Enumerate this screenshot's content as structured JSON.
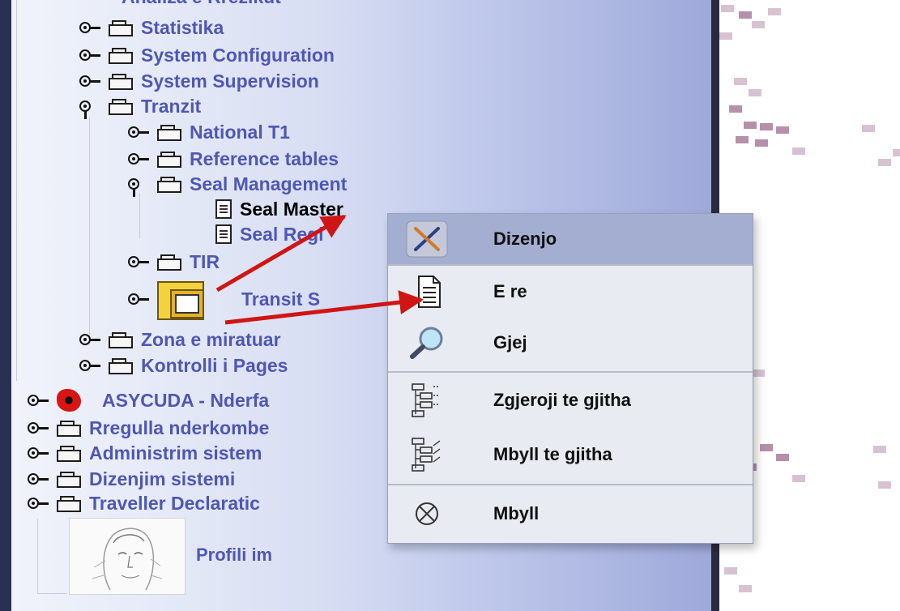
{
  "tree": {
    "top_partial": "Analiza e Rrezikut",
    "items": [
      {
        "label": "Statistika"
      },
      {
        "label": "System Configuration"
      },
      {
        "label": "System Supervision"
      },
      {
        "label": "Tranzit"
      },
      {
        "label": "National T1"
      },
      {
        "label": "Reference tables"
      },
      {
        "label": "Seal Management"
      },
      {
        "label": "Seal Master"
      },
      {
        "label": "Seal Regi"
      },
      {
        "label": "TIR"
      },
      {
        "label": "Transit S"
      },
      {
        "label": "Zona e miratuar"
      },
      {
        "label": "Kontrolli i Pages"
      },
      {
        "label": "ASYCUDA - Nderfa"
      },
      {
        "label": "Rregulla nderkombe"
      },
      {
        "label": "Administrim sistem"
      },
      {
        "label": "Dizenjim sistemi"
      },
      {
        "label": "Traveller Declaratic"
      }
    ],
    "profile_label": "Profili im"
  },
  "context_menu": {
    "items": [
      {
        "label": "Dizenjo",
        "icon": "design-tools-icon",
        "highlighted": true
      },
      {
        "label": "E re",
        "icon": "new-document-icon"
      },
      {
        "label": "Gjej",
        "icon": "search-magnifier-icon"
      },
      {
        "label": "Zgjeroji te gjitha",
        "icon": "expand-all-icon"
      },
      {
        "label": "Mbyll te gjitha",
        "icon": "collapse-all-icon"
      },
      {
        "label": "Mbyll",
        "icon": "close-circle-icon"
      }
    ]
  },
  "colors": {
    "tree_text": "#4f57b3",
    "selected_text": "#000000",
    "menu_highlight": "#a4aed1",
    "annotation_arrow": "#d01515",
    "right_pattern": "#d7c2d2"
  }
}
